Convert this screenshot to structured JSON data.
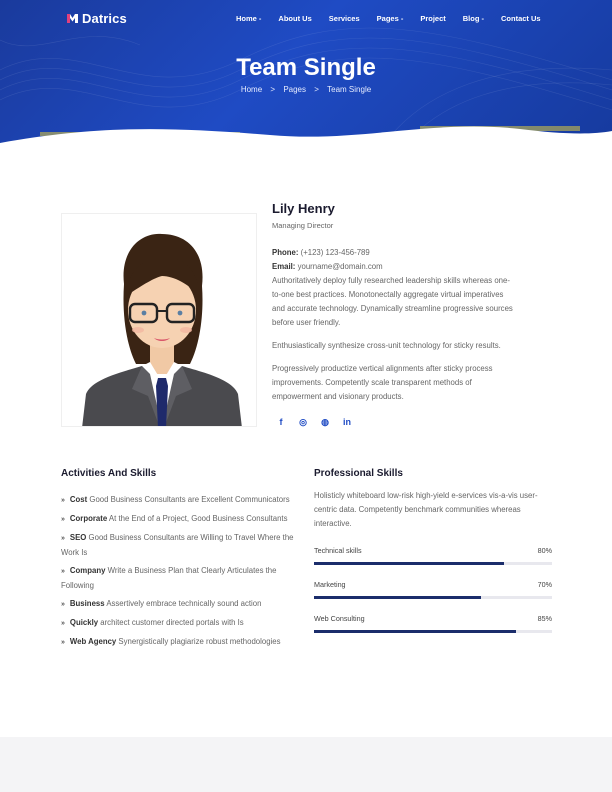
{
  "brand": {
    "name": "Datrics"
  },
  "nav": {
    "items": [
      {
        "label": "Home -"
      },
      {
        "label": "About Us"
      },
      {
        "label": "Services"
      },
      {
        "label": "Pages -"
      },
      {
        "label": "Project"
      },
      {
        "label": "Blog -"
      },
      {
        "label": "Contact Us"
      }
    ]
  },
  "hero": {
    "title": "Team Single",
    "breadcrumb": {
      "home": "Home",
      "sep1": ">",
      "pages": "Pages",
      "sep2": ">",
      "current": "Team Single"
    }
  },
  "profile": {
    "name": "Lily Henry",
    "role": "Managing Director",
    "phone_label": "Phone:",
    "phone": "(+123) 123-456-789",
    "email_label": "Email:",
    "email": "yourname@domain.com",
    "p1": "Authoritatively deploy fully researched leadership skills whereas one-to-one best practices. Monotonectally aggregate virtual imperatives and accurate technology. Dynamically streamline progressive sources before user friendly.",
    "p2": "Enthusiastically synthesize cross-unit technology for sticky results.",
    "p3": "Progressively productize vertical alignments after sticky process improvements. Competently scale transparent methods of empowerment and visionary products.",
    "socials": [
      "f",
      "◎",
      "◍",
      "in"
    ]
  },
  "activities": {
    "title": "Activities And Skills",
    "items": [
      {
        "bold": "Cost",
        "text": " Good Business Consultants are Excellent Communicators"
      },
      {
        "bold": "Corporate",
        "text": " At the End of a Project, Good Business Consultants"
      },
      {
        "bold": "SEO",
        "text": " Good Business Consultants are Willing to Travel Where the Work Is"
      },
      {
        "bold": "Company",
        "text": " Write a Business Plan that Clearly Articulates the Following"
      },
      {
        "bold": "Business",
        "text": " Assertively embrace technically sound action"
      },
      {
        "bold": "Quickly",
        "text": " architect customer directed portals with Is"
      },
      {
        "bold": "Web Agency",
        "text": " Synergistically plagiarize robust methodologies"
      }
    ]
  },
  "professional": {
    "title": "Professional Skills",
    "desc": "Holisticly whiteboard low-risk high-yield e-services vis-a-vis user-centric data. Competently benchmark communities whereas interactive.",
    "skills": [
      {
        "label": "Technical skills",
        "percent_text": "80%",
        "value": 0.8
      },
      {
        "label": "Marketing",
        "percent_text": "70%",
        "value": 0.7
      },
      {
        "label": "Web Consulting",
        "percent_text": "85%",
        "value": 0.85
      }
    ]
  },
  "colors": {
    "hero": "#1f4bc4",
    "accent": "#1f4bc4",
    "bar_fill": "#1b2d6b",
    "logo_mark": "#e0417d"
  }
}
